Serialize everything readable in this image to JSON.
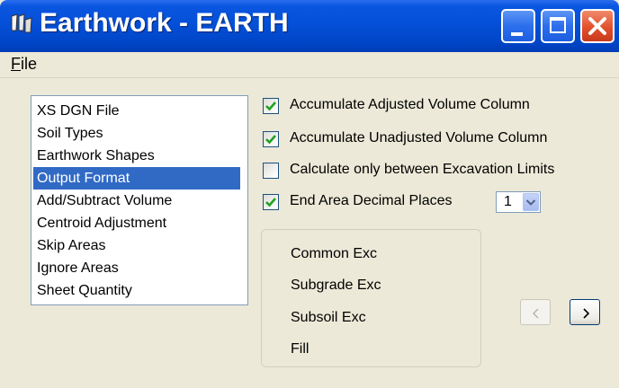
{
  "window": {
    "title": "Earthwork - EARTH"
  },
  "menu": {
    "file_accel": "F",
    "file_rest": "ile"
  },
  "list": {
    "items": [
      "XS DGN File",
      "Soil Types",
      "Earthwork Shapes",
      "Output Format",
      "Add/Subtract Volume",
      "Centroid Adjustment",
      "Skip Areas",
      "Ignore Areas",
      "Sheet Quantity"
    ],
    "selected": "Output Format"
  },
  "options": {
    "accumulate_adjusted": {
      "label": "Accumulate Adjusted Volume Column",
      "checked": true
    },
    "accumulate_unadjusted": {
      "label": "Accumulate Unadjusted Volume Column",
      "checked": true
    },
    "calc_between_limits": {
      "label": "Calculate only between Excavation Limits",
      "checked": false
    },
    "end_area_decimals": {
      "label": "End Area Decimal Places",
      "checked": true,
      "value": "1"
    }
  },
  "group": {
    "items": [
      "Common Exc",
      "Subgrade Exc",
      "Subsoil Exc",
      "Fill"
    ]
  },
  "nav": {
    "prev_enabled": false,
    "next_enabled": true
  },
  "colors": {
    "titlebar": "#0450d8",
    "selection": "#316ac5",
    "close": "#e2502d",
    "check": "#21a121"
  },
  "icons": {
    "app": "earthwork-app-icon",
    "minimize": "minimize-icon",
    "maximize": "maximize-icon",
    "close": "close-icon",
    "checkmark": "checkmark-icon",
    "dropdown": "chevron-down-icon",
    "prev": "chevron-left-icon",
    "next": "chevron-right-icon"
  }
}
